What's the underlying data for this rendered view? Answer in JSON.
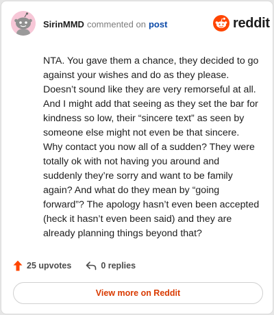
{
  "header": {
    "username": "SirinMMD",
    "action": "commented on",
    "post_link": "post",
    "logo_text": "reddit"
  },
  "comment": {
    "text": "NTA. You gave them a chance, they decided to go against your wishes and do as they please. Doesn’t sound like they are very remorseful at all. And I might add that seeing as they set the bar for kindness so low, their “sincere text” as seen by someone else might not even be that sincere. Why contact you now all of a sudden? They were totally ok with not having you around and suddenly they’re sorry and want to be family again? And what do they mean by “going forward”? The apology hasn’t even been accepted (heck it hasn’t even been said) and they are already planning things beyond that?"
  },
  "actions": {
    "upvotes": "25 upvotes",
    "replies": "0 replies"
  },
  "footer": {
    "view_more": "View more on Reddit"
  },
  "colors": {
    "brand": "#ff4500",
    "link": "#0a49a8",
    "avatar_bg": "#f7c7d7",
    "view_more": "#d93a00"
  },
  "icons": {
    "avatar": "snoo-avatar-icon",
    "logo": "reddit-alien-icon",
    "upvote": "upvote-arrow-icon",
    "reply": "reply-arrow-icon"
  }
}
